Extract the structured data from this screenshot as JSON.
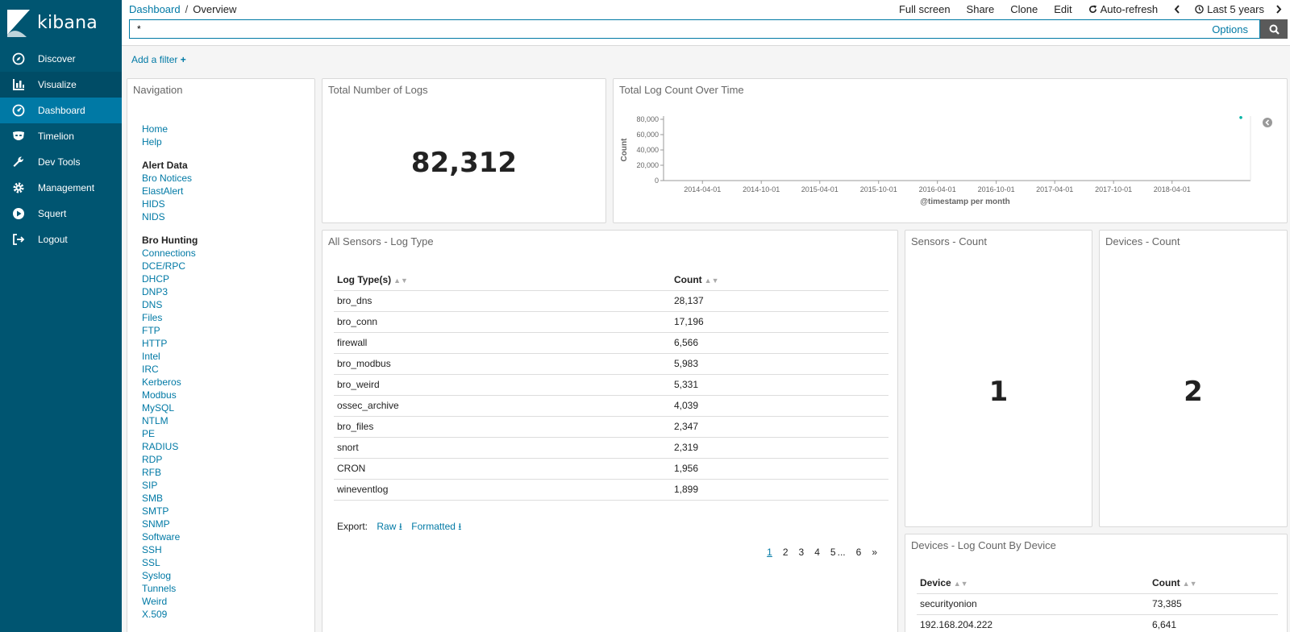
{
  "app": {
    "logo_text": "kibana"
  },
  "sidebar": {
    "items": [
      {
        "label": "Discover",
        "icon": "compass-icon"
      },
      {
        "label": "Visualize",
        "icon": "bar-chart-icon"
      },
      {
        "label": "Dashboard",
        "icon": "dashboard-icon"
      },
      {
        "label": "Timelion",
        "icon": "mask-icon"
      },
      {
        "label": "Dev Tools",
        "icon": "wrench-icon"
      },
      {
        "label": "Management",
        "icon": "gear-icon"
      },
      {
        "label": "Squert",
        "icon": "play-icon"
      },
      {
        "label": "Logout",
        "icon": "logout-icon"
      }
    ]
  },
  "breadcrumb": {
    "parent": "Dashboard",
    "sep": "/",
    "current": "Overview"
  },
  "top_actions": {
    "full_screen": "Full screen",
    "share": "Share",
    "clone": "Clone",
    "edit": "Edit",
    "auto_refresh": "Auto-refresh",
    "time_range": "Last 5 years"
  },
  "query": {
    "value": "*",
    "options_label": "Options"
  },
  "filter": {
    "add_label": "Add a filter"
  },
  "navigation_panel": {
    "title": "Navigation",
    "home": "Home",
    "help": "Help",
    "alert_header": "Alert Data",
    "alert_links": [
      "Bro Notices",
      "ElastAlert",
      "HIDS",
      "NIDS"
    ],
    "hunting_header": "Bro Hunting",
    "hunting_links": [
      "Connections",
      "DCE/RPC",
      "DHCP",
      "DNP3",
      "DNS",
      "Files",
      "FTP",
      "HTTP",
      "Intel",
      "IRC",
      "Kerberos",
      "Modbus",
      "MySQL",
      "NTLM",
      "PE",
      "RADIUS",
      "RDP",
      "RFB",
      "SIP",
      "SMB",
      "SMTP",
      "SNMP",
      "Software",
      "SSH",
      "SSL",
      "Syslog",
      "Tunnels",
      "Weird",
      "X.509"
    ]
  },
  "total_logs": {
    "title": "Total Number of Logs",
    "value": "82,312"
  },
  "log_count_chart": {
    "title": "Total Log Count Over Time",
    "colors": {
      "point": "#00b3a4",
      "axis": "#999999"
    }
  },
  "chart_data": {
    "type": "scatter",
    "title": "Total Log Count Over Time",
    "xlabel": "@timestamp per month",
    "ylabel": "Count",
    "x_ticks": [
      "2014-04-01",
      "2014-10-01",
      "2015-04-01",
      "2015-10-01",
      "2016-04-01",
      "2016-10-01",
      "2017-04-01",
      "2017-10-01",
      "2018-04-01"
    ],
    "y_ticks": [
      "0",
      "20,000",
      "40,000",
      "60,000",
      "80,000"
    ],
    "ylim": [
      0,
      80000
    ],
    "xlim": [
      "2013-12-01",
      "2018-12-01"
    ],
    "points": [
      {
        "x": "2018-11-01",
        "y": 82312
      }
    ],
    "grid": false
  },
  "log_type_panel": {
    "title": "All Sensors - Log Type",
    "headers": [
      "Log Type(s)",
      "Count"
    ],
    "rows": [
      [
        "bro_dns",
        "28,137"
      ],
      [
        "bro_conn",
        "17,196"
      ],
      [
        "firewall",
        "6,566"
      ],
      [
        "bro_modbus",
        "5,983"
      ],
      [
        "bro_weird",
        "5,331"
      ],
      [
        "ossec_archive",
        "4,039"
      ],
      [
        "bro_files",
        "2,347"
      ],
      [
        "snort",
        "2,319"
      ],
      [
        "CRON",
        "1,956"
      ],
      [
        "wineventlog",
        "1,899"
      ]
    ],
    "export_label": "Export:",
    "raw_label": "Raw",
    "formatted_label": "Formatted",
    "pages": [
      "1",
      "2",
      "3",
      "4",
      "5",
      "...",
      "6",
      "»"
    ]
  },
  "sensors_count": {
    "title": "Sensors - Count",
    "value": "1"
  },
  "devices_count": {
    "title": "Devices - Count",
    "value": "2"
  },
  "device_log_panel": {
    "title": "Devices - Log Count By Device",
    "headers": [
      "Device",
      "Count"
    ],
    "rows": [
      [
        "securityonion",
        "73,385"
      ],
      [
        "192.168.204.222",
        "6,641"
      ]
    ]
  }
}
